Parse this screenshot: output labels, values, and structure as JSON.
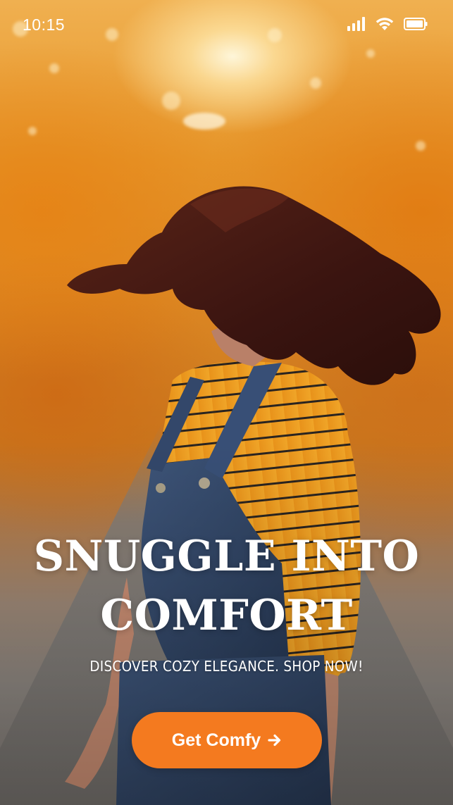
{
  "status_bar": {
    "time": "10:15",
    "icons": [
      "signal-icon",
      "wifi-icon",
      "battery-icon"
    ]
  },
  "hero": {
    "title": "SNUGGLE INTO COMFORT",
    "subtitle": "DISCOVER COZY ELEGANCE. SHOP NOW!"
  },
  "cta": {
    "label": "Get Comfy",
    "icon": "arrow-right-icon",
    "color": "#f47a1f"
  },
  "background": {
    "description_icon": "hero-photo",
    "accent_colors": [
      "#e6962a",
      "#d98422",
      "#7c7874"
    ]
  }
}
